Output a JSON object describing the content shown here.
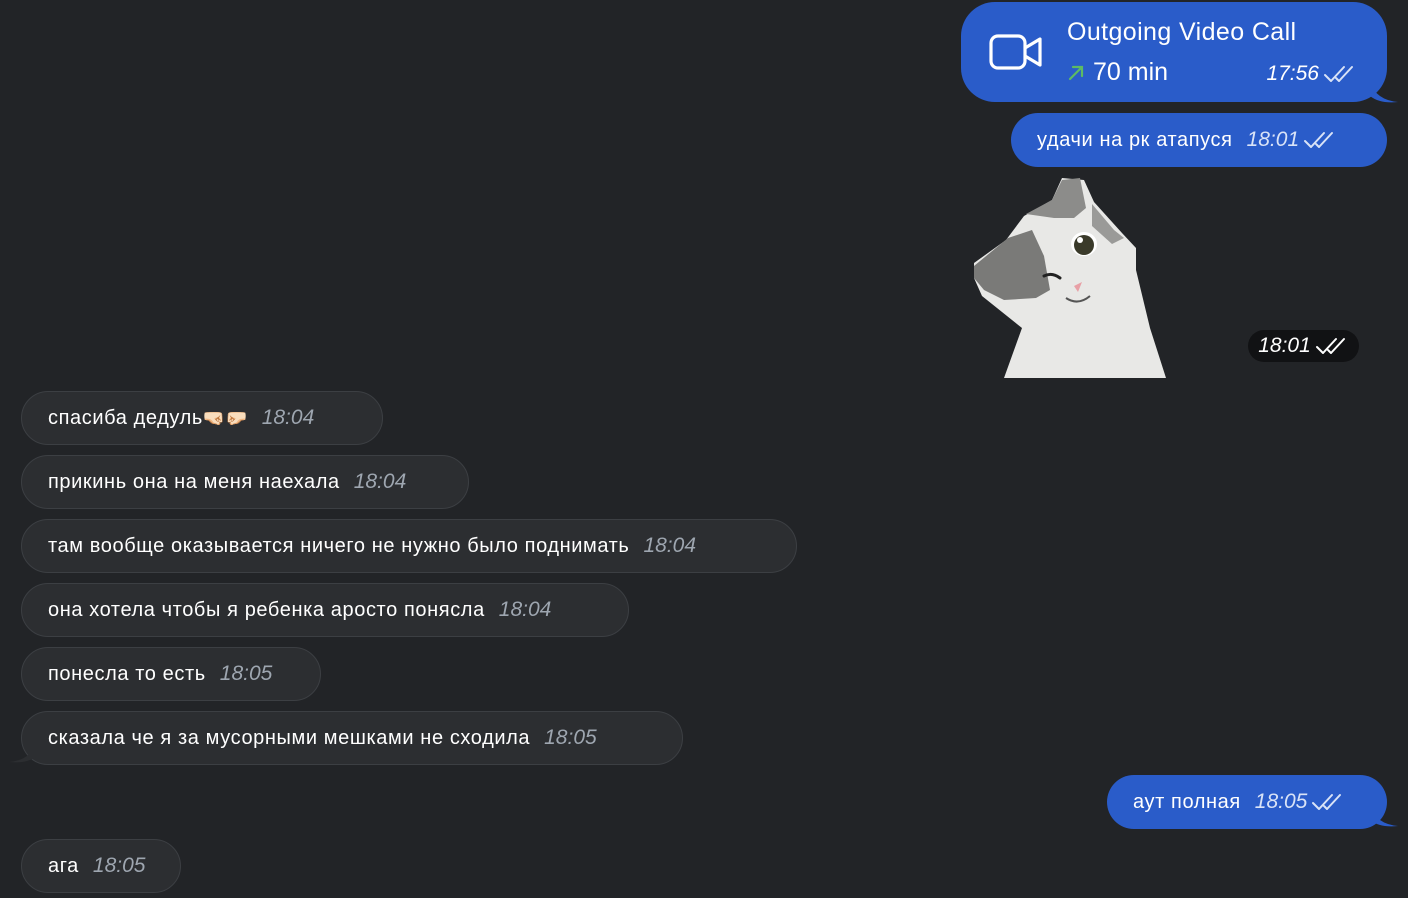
{
  "call": {
    "title": "Outgoing Video Call",
    "duration": "70 min",
    "time": "17:56",
    "icon": "video-camera-icon",
    "direction_icon": "outgoing-arrow-icon"
  },
  "messages": {
    "out1": {
      "text": "удачи на рк атапуся",
      "time": "18:01"
    },
    "sticker": {
      "time": "18:01",
      "icon": "cat-wink-sticker"
    },
    "in1": {
      "text": "спасиба дедуль",
      "emoji": "🤜🏻🤛🏻",
      "time": "18:04"
    },
    "in2": {
      "text": "прикинь она на меня наехала",
      "time": "18:04"
    },
    "in3": {
      "text": "там вообще оказывается ничего не нужно было поднимать",
      "time": "18:04"
    },
    "in4": {
      "text": "она хотела чтобы я ребенка аросто понясла",
      "time": "18:04"
    },
    "in5": {
      "text": "понесла то есть",
      "time": "18:05"
    },
    "in6": {
      "text": "сказала че я за мусорными мешками не сходила",
      "time": "18:05"
    },
    "out2": {
      "text": "аут полная",
      "time": "18:05"
    },
    "in7": {
      "text": "ага",
      "time": "18:05"
    }
  },
  "colors": {
    "background": "#222427",
    "outgoing_bubble": "#2a5cc9",
    "incoming_bubble": "#2c2e31",
    "arrow_green": "#5dbb63"
  }
}
